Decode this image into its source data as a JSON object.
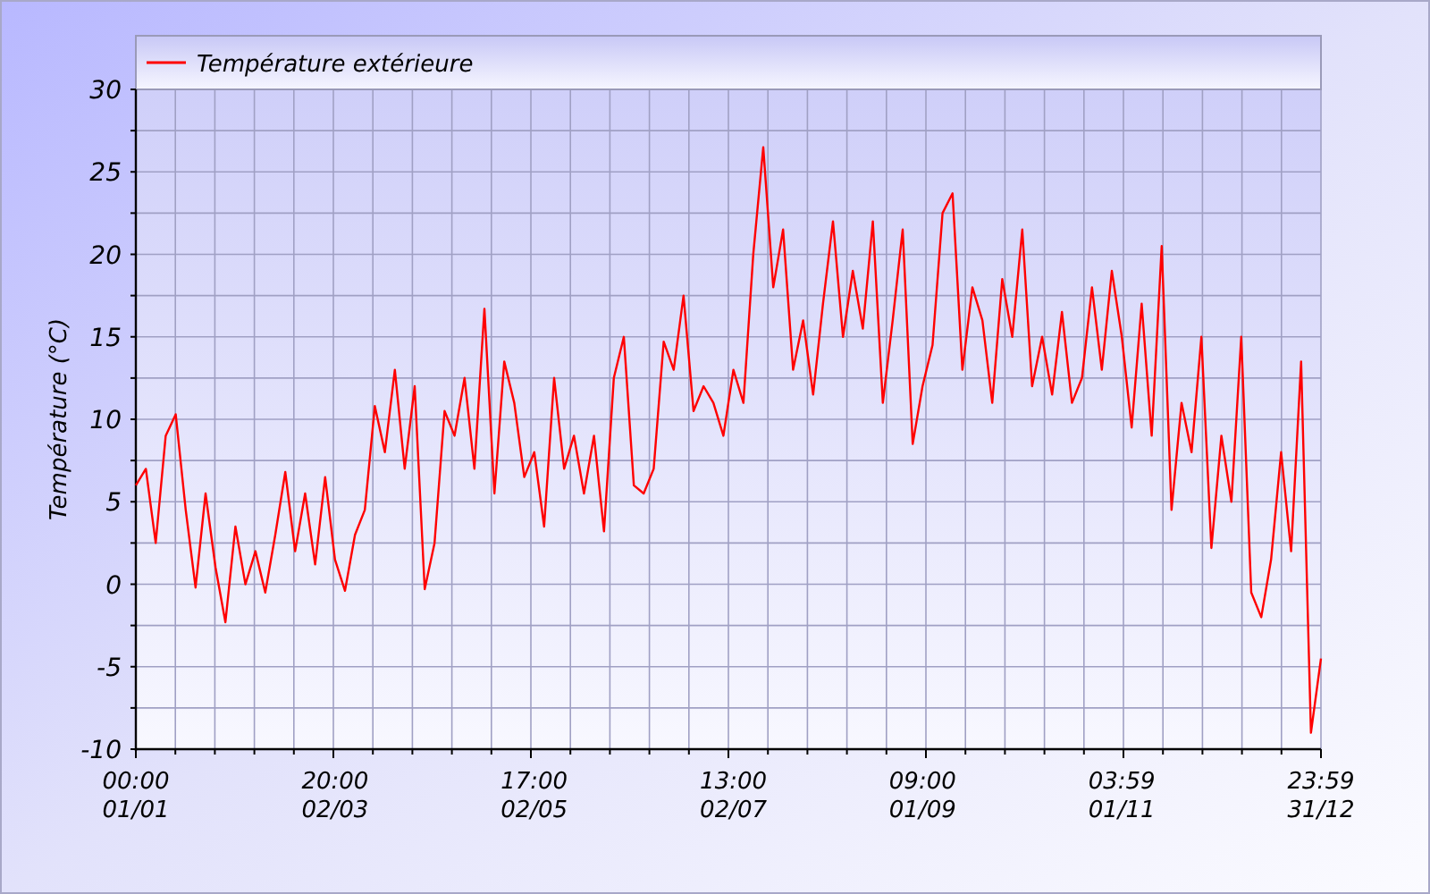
{
  "chart_data": {
    "type": "line",
    "grid": true,
    "categories": [
      "00:00\n01/01",
      null,
      null,
      null,
      null,
      null,
      null,
      null,
      null,
      null,
      null,
      null,
      null,
      null,
      null,
      null,
      null,
      null,
      null,
      null,
      "20:00\n02/03",
      null,
      null,
      null,
      null,
      null,
      null,
      null,
      null,
      null,
      null,
      null,
      null,
      null,
      null,
      null,
      null,
      null,
      null,
      null,
      "17:00\n02/05",
      null,
      null,
      null,
      null,
      null,
      null,
      null,
      null,
      null,
      null,
      null,
      null,
      null,
      null,
      null,
      null,
      null,
      null,
      null,
      "13:00\n02/07",
      null,
      null,
      null,
      null,
      null,
      null,
      null,
      null,
      null,
      null,
      null,
      null,
      null,
      null,
      null,
      null,
      null,
      null,
      "09:00\n01/09",
      null,
      null,
      null,
      null,
      null,
      null,
      null,
      null,
      null,
      null,
      null,
      null,
      null,
      null,
      null,
      null,
      null,
      null,
      null,
      "03:59\n01/11",
      null,
      null,
      null,
      null,
      null,
      null,
      null,
      null,
      null,
      null,
      null,
      null,
      null,
      null,
      null,
      null,
      null,
      null,
      null,
      "23:59\n31/12"
    ],
    "ylabel": "Température (°C)",
    "ylim": [
      -10,
      30
    ],
    "yticks": [
      -10,
      -5,
      0,
      5,
      10,
      15,
      20,
      25,
      30
    ],
    "series": [
      {
        "name": "Température extérieure",
        "color": "#ff0000",
        "values": [
          6,
          7,
          2.5,
          9,
          10.3,
          4.5,
          -0.2,
          5.5,
          1,
          -2.3,
          3.5,
          0,
          2,
          -0.5,
          3,
          6.8,
          2,
          5.5,
          1.2,
          6.5,
          1.5,
          -0.4,
          3,
          4.5,
          10.8,
          8,
          13,
          7,
          12,
          -0.3,
          2.5,
          10.5,
          9,
          12.5,
          7,
          16.7,
          5.5,
          13.5,
          11,
          6.5,
          8,
          3.5,
          12.5,
          7,
          9,
          5.5,
          9,
          3.2,
          12.5,
          15,
          6,
          5.5,
          7,
          14.7,
          13,
          17.5,
          10.5,
          12,
          11,
          9,
          13,
          11,
          20,
          26.5,
          18,
          21.5,
          13,
          16,
          11.5,
          17,
          22,
          15,
          19,
          15.5,
          22,
          11,
          16,
          21.5,
          8.5,
          12,
          14.5,
          22.5,
          23.7,
          13,
          18,
          16,
          11,
          18.5,
          15,
          21.5,
          12,
          15,
          11.5,
          16.5,
          11,
          12.5,
          18,
          13,
          19,
          15,
          9.5,
          17,
          9,
          20.5,
          4.5,
          11,
          8,
          15,
          2.2,
          9,
          5,
          15,
          -0.5,
          -2,
          1.5,
          8,
          2,
          13.5,
          -9,
          -4.5
        ]
      }
    ]
  }
}
